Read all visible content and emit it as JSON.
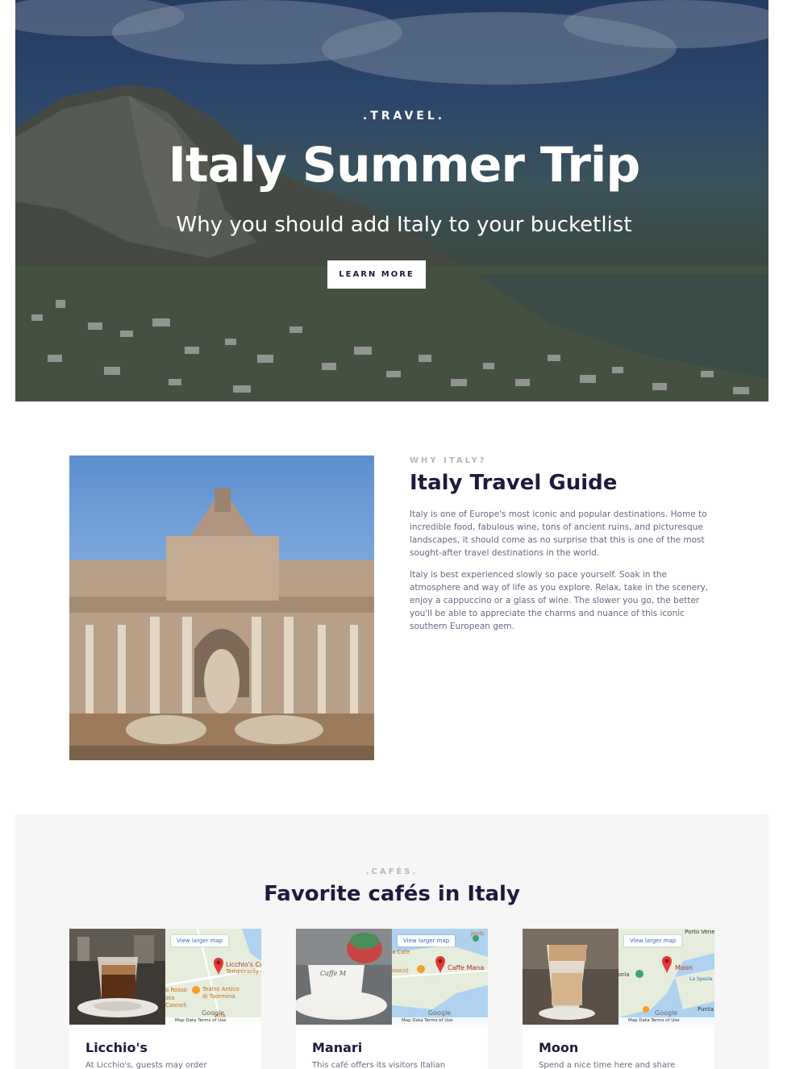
{
  "hero": {
    "eyebrow": ".TRAVEL.",
    "title": "Italy Summer Trip",
    "subtitle": "Why you should add Italy to your bucketlist",
    "button_label": "LEARN MORE"
  },
  "guide": {
    "eyebrow": "WHY ITALY?",
    "title": "Italy Travel Guide",
    "paragraph_1": "Italy is one of Europe's most iconic and popular destinations. Home to incredible food, fabulous wine, tons of ancient ruins, and picturesque landscapes, it should come as no surprise that this is one of the most sought-after travel destinations in the world.",
    "paragraph_2": "Italy is best experienced slowly so pace yourself. Soak in the atmosphere and way of life as you explore. Relax, take in the scenery, enjoy a cappuccino or a glass of wine. The slower you go, the better you'll be able to appreciate the charms and nuance of this iconic southern European gem."
  },
  "cafes": {
    "eyebrow": ".CAFÉS.",
    "title": "Favorite cafés in Italy",
    "map_larger_label": "View larger map",
    "map_footer": "Map Data   Terms of Use",
    "map_logo": "Google",
    "items": [
      {
        "name": "Licchio's",
        "description": "At Licchio's, guests may order",
        "map_place": "Licchio's Co",
        "map_place_note": "Temporarily cl",
        "map_poi_1": "Teatro Antico",
        "map_poi_1b": "di Taormina",
        "map_poi_2": "o Rosso",
        "map_poi_3": "ata",
        "map_poi_4": "Cannoli",
        "map_poi_5": "Villa"
      },
      {
        "name": "Manari",
        "description": "This café offers its visitors Italian",
        "map_place": "Caffe Mana",
        "map_poi_1": "a Cafe",
        "map_poi_2": "iosco)",
        "map_poi_3": "Jovis"
      },
      {
        "name": "Moon",
        "description": "Spend a nice time here and share",
        "map_place": "Moon",
        "map_poi_1": "Porto Venere",
        "map_poi_2": "oria",
        "map_poi_3": "La Spezia",
        "map_poi_4": "Punta"
      }
    ]
  },
  "colors": {
    "heading": "#1f1a3d",
    "body_text": "#6a6880",
    "eyebrow": "#b7b5c2",
    "section_bg": "#f6f6f6",
    "map_link": "#3568c9"
  }
}
